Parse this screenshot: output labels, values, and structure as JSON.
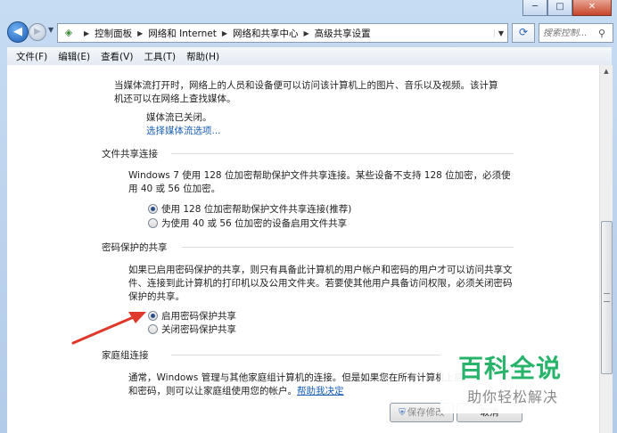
{
  "window": {
    "minimize": "─",
    "maximize": "□",
    "close": "✕"
  },
  "address": {
    "crumbs": [
      "控制面板",
      "网络和 Internet",
      "网络和共享中心",
      "高级共享设置"
    ],
    "search_placeholder": "搜索控制..."
  },
  "menu": [
    "文件(F)",
    "编辑(E)",
    "查看(V)",
    "工具(T)",
    "帮助(H)"
  ],
  "media": {
    "description": "当媒体流打开时，网络上的人员和设备便可以访问该计算机上的图片、音乐以及视频。该计算机还可以在网络上查找媒体。",
    "status": "媒体流已关闭。",
    "link": "选择媒体流选项..."
  },
  "file_sharing": {
    "heading": "文件共享连接",
    "description": "Windows 7 使用 128 位加密帮助保护文件共享连接。某些设备不支持 128 位加密，必须使用 40 或 56 位加密。",
    "options": [
      {
        "label": "使用 128 位加密帮助保护文件共享连接(推荐)",
        "checked": true
      },
      {
        "label": "为使用 40 或 56 位加密的设备启用文件共享",
        "checked": false
      }
    ]
  },
  "password_sharing": {
    "heading": "密码保护的共享",
    "description": "如果已启用密码保护的共享，则只有具备此计算机的用户帐户和密码的用户才可以访问共享文件、连接到此计算机的打印机以及公用文件夹。若要使其他用户具备访问权限，必须关闭密码保护的共享。",
    "options": [
      {
        "label": "启用密码保护共享",
        "checked": true
      },
      {
        "label": "关闭密码保护共享",
        "checked": false
      }
    ]
  },
  "homegroup": {
    "heading": "家庭组连接",
    "description": "通常，Windows 管理与其他家庭组计算机的连接。但是如果您在所有计算机上拥",
    "description2": "和密码，则可以让家庭组使用您的帐户。",
    "link": "帮助我决定"
  },
  "buttons": {
    "save": "保存修改",
    "cancel": "取消"
  },
  "watermark": {
    "title": "百科全说",
    "subtitle": "助你轻松解决"
  },
  "colors": {
    "link": "#1a5fb4",
    "arrow": "#e0392b",
    "watermark_green": "#27b36a"
  }
}
